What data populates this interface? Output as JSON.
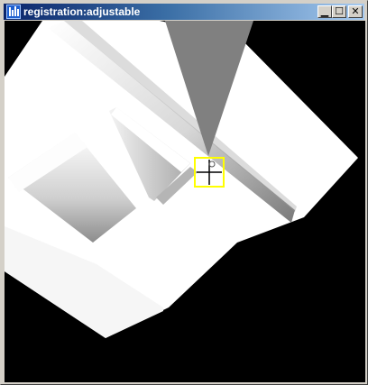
{
  "window": {
    "title": "registration:adjustable",
    "buttons": {
      "minimize_icon": "minimize-icon",
      "maximize_icon": "maximize-icon",
      "close_icon": "close-icon"
    }
  },
  "scene": {
    "background_color": "#000000",
    "surface_color": "#ffffff",
    "cone_color": "#808080",
    "marker_color": "#ffff00",
    "crosshair_color": "#000000"
  }
}
